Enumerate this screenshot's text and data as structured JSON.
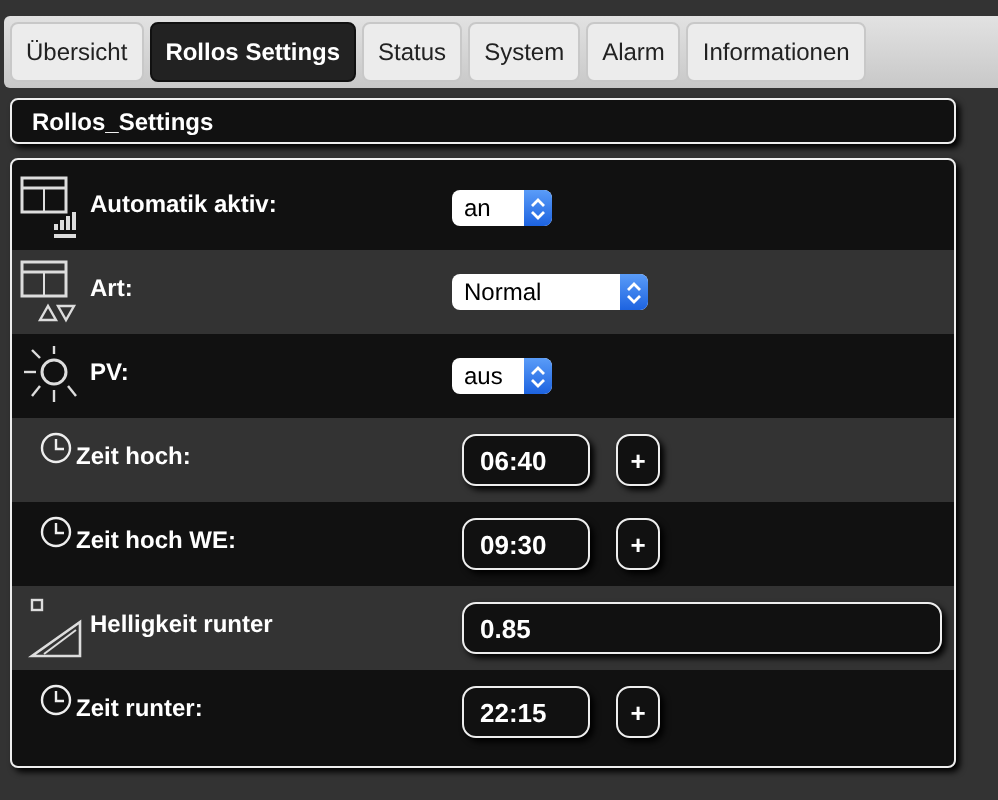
{
  "tabs": [
    {
      "label": "Übersicht",
      "selected": false
    },
    {
      "label": "Rollos Settings",
      "selected": true
    },
    {
      "label": "Status",
      "selected": false
    },
    {
      "label": "System",
      "selected": false
    },
    {
      "label": "Alarm",
      "selected": false
    },
    {
      "label": "Informationen",
      "selected": false
    }
  ],
  "header": {
    "title": "Rollos_Settings"
  },
  "rows": [
    {
      "kind": "select",
      "label": "Automatik aktiv:",
      "value": "an"
    },
    {
      "kind": "select",
      "label": "Art:",
      "value": "Normal"
    },
    {
      "kind": "select",
      "label": "PV:",
      "value": "aus"
    },
    {
      "kind": "time",
      "label": "Zeit hoch:",
      "value": "06:40",
      "button": "+"
    },
    {
      "kind": "time",
      "label": "Zeit hoch WE:",
      "value": "09:30",
      "button": "+"
    },
    {
      "kind": "number",
      "label": "Helligkeit runter",
      "value": "0.85"
    },
    {
      "kind": "time",
      "label": "Zeit runter:",
      "value": "22:15",
      "button": "+"
    }
  ]
}
